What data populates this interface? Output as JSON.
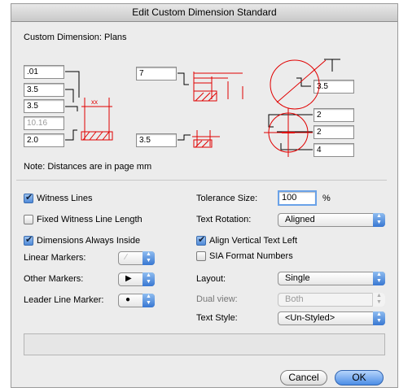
{
  "window": {
    "title": "Edit Custom Dimension Standard"
  },
  "custom_dimension_label": "Custom Dimension: Plans",
  "fields": {
    "f1": ".01",
    "f2": "3.5",
    "f3": "3.5",
    "f4": "10.16",
    "f5": "2.0",
    "f6": "7",
    "f7": "3.5",
    "f8": "3.5",
    "f9": "2",
    "f10": "2",
    "f11": "4"
  },
  "diagram_text": {
    "xx": "xx"
  },
  "note": "Note: Distances are in page mm",
  "left": {
    "witness_lines": {
      "label": "Witness Lines",
      "checked": true
    },
    "fixed_witness": {
      "label": "Fixed Witness Line Length",
      "checked": false
    },
    "dims_inside": {
      "label": "Dimensions Always Inside",
      "checked": true
    },
    "linear_markers_label": "Linear Markers:",
    "other_markers_label": "Other Markers:",
    "leader_marker_label": "Leader Line Marker:"
  },
  "right": {
    "tolerance_label": "Tolerance Size:",
    "tolerance_value": "100",
    "percent": "%",
    "text_rotation_label": "Text Rotation:",
    "text_rotation_value": "Aligned",
    "align_vertical": {
      "label": "Align Vertical Text Left",
      "checked": true
    },
    "sia_format": {
      "label": "SIA Format Numbers",
      "checked": false
    },
    "layout_label": "Layout:",
    "layout_value": "Single",
    "dual_view_label": "Dual view:",
    "dual_view_value": "Both",
    "text_style_label": "Text Style:",
    "text_style_value": "<Un-Styled>"
  },
  "buttons": {
    "cancel": "Cancel",
    "ok": "OK"
  },
  "colors": {
    "diagram_red": "#e00000",
    "accent": "#3877d2"
  }
}
